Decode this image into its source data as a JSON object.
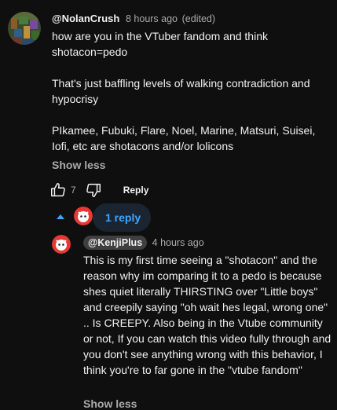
{
  "comment": {
    "author": "@NolanCrush",
    "timestamp": "8 hours ago",
    "edited": "(edited)",
    "paragraphs": [
      "how are you in the VTuber fandom and think shotacon=pedo",
      "That's just baffling levels of walking contradiction and hypocrisy",
      "PIkamee, Fubuki, Flare, Noel, Marine, Matsuri, Suisei, Iofi, etc are shotacons and/or lolicons"
    ],
    "show_less": "Show less",
    "like_count": "7",
    "reply_label": "Reply",
    "icons": {
      "like": "thumbs-up-icon",
      "dislike": "thumbs-down-icon"
    }
  },
  "replies_toggle": {
    "label": "1 reply",
    "icon": "chevron-up-icon",
    "accent": "#3ea6ff"
  },
  "reply": {
    "author": "@KenjiPlus",
    "timestamp": "4 hours ago",
    "text": "This is my first time seeing a \"shotacon\" and the reason why im comparing it to a pedo is because shes quiet literally THIRSTING over \"Little boys\" and creepily saying \"oh wait hes legal, wrong one\" .. Is CREEPY. Also being in the Vtube community or not, If you can watch this video fully through and you don't see anything wrong with this behavior, I think you're to far gone in the \"vtube fandom\"",
    "show_less": "Show less"
  },
  "colors": {
    "background": "#0f0f0f",
    "text_primary": "#f1f1f1",
    "text_secondary": "#aaaaaa",
    "link": "#3ea6ff",
    "reply_avatar_red": "#e53935"
  }
}
